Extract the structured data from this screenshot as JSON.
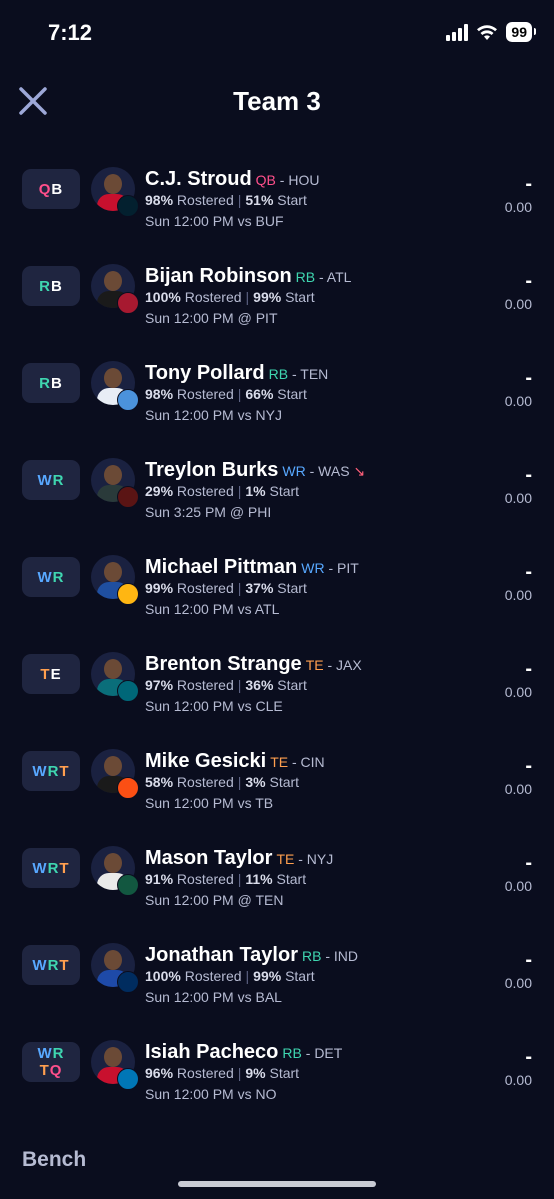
{
  "status_bar": {
    "time": "7:12",
    "battery": "99"
  },
  "header": {
    "title": "Team 3",
    "close_icon": "close-icon"
  },
  "colors": {
    "qb": "#ff4f8b",
    "rb": "#3fd6b0",
    "wr": "#58a8ff",
    "te": "#ff9f4f",
    "background": "#0a0d1e"
  },
  "roster": [
    {
      "slot": [
        "QB"
      ],
      "name": "C.J. Stroud",
      "pos": "QB",
      "team": "HOU",
      "rostered": "98%",
      "rostered_label": "Rostered",
      "start": "51%",
      "start_label": "Start",
      "game": "Sun 12:00 PM vs BUF",
      "score_dash": "-",
      "score": "0.00"
    },
    {
      "slot": [
        "RB"
      ],
      "name": "Bijan Robinson",
      "pos": "RB",
      "team": "ATL",
      "rostered": "100%",
      "rostered_label": "Rostered",
      "start": "99%",
      "start_label": "Start",
      "game": "Sun 12:00 PM @ PIT",
      "score_dash": "-",
      "score": "0.00"
    },
    {
      "slot": [
        "RB"
      ],
      "name": "Tony Pollard",
      "pos": "RB",
      "team": "TEN",
      "rostered": "98%",
      "rostered_label": "Rostered",
      "start": "66%",
      "start_label": "Start",
      "game": "Sun 12:00 PM vs NYJ",
      "score_dash": "-",
      "score": "0.00"
    },
    {
      "slot": [
        "WR"
      ],
      "name": "Treylon Burks",
      "pos": "WR",
      "team": "WAS",
      "trend": "↘",
      "rostered": "29%",
      "rostered_label": "Rostered",
      "start": "1%",
      "start_label": "Start",
      "game": "Sun 3:25 PM @ PHI",
      "score_dash": "-",
      "score": "0.00"
    },
    {
      "slot": [
        "WR"
      ],
      "name": "Michael Pittman",
      "pos": "WR",
      "team": "PIT",
      "rostered": "99%",
      "rostered_label": "Rostered",
      "start": "37%",
      "start_label": "Start",
      "game": "Sun 12:00 PM vs ATL",
      "score_dash": "-",
      "score": "0.00"
    },
    {
      "slot": [
        "TE"
      ],
      "name": "Brenton Strange",
      "pos": "TE",
      "team": "JAX",
      "rostered": "97%",
      "rostered_label": "Rostered",
      "start": "36%",
      "start_label": "Start",
      "game": "Sun 12:00 PM vs CLE",
      "score_dash": "-",
      "score": "0.00"
    },
    {
      "slot": [
        "WRT"
      ],
      "name": "Mike Gesicki",
      "pos": "TE",
      "team": "CIN",
      "rostered": "58%",
      "rostered_label": "Rostered",
      "start": "3%",
      "start_label": "Start",
      "game": "Sun 12:00 PM vs TB",
      "score_dash": "-",
      "score": "0.00"
    },
    {
      "slot": [
        "WRT"
      ],
      "name": "Mason Taylor",
      "pos": "TE",
      "team": "NYJ",
      "rostered": "91%",
      "rostered_label": "Rostered",
      "start": "11%",
      "start_label": "Start",
      "game": "Sun 12:00 PM @ TEN",
      "score_dash": "-",
      "score": "0.00"
    },
    {
      "slot": [
        "WRT"
      ],
      "name": "Jonathan Taylor",
      "pos": "RB",
      "team": "IND",
      "rostered": "100%",
      "rostered_label": "Rostered",
      "start": "99%",
      "start_label": "Start",
      "game": "Sun 12:00 PM vs BAL",
      "score_dash": "-",
      "score": "0.00"
    },
    {
      "slot": [
        "WR",
        "TQ"
      ],
      "name": "Isiah Pacheco",
      "pos": "RB",
      "team": "DET",
      "rostered": "96%",
      "rostered_label": "Rostered",
      "start": "9%",
      "start_label": "Start",
      "game": "Sun 12:00 PM vs NO",
      "score_dash": "-",
      "score": "0.00"
    }
  ],
  "bench_label": "Bench"
}
